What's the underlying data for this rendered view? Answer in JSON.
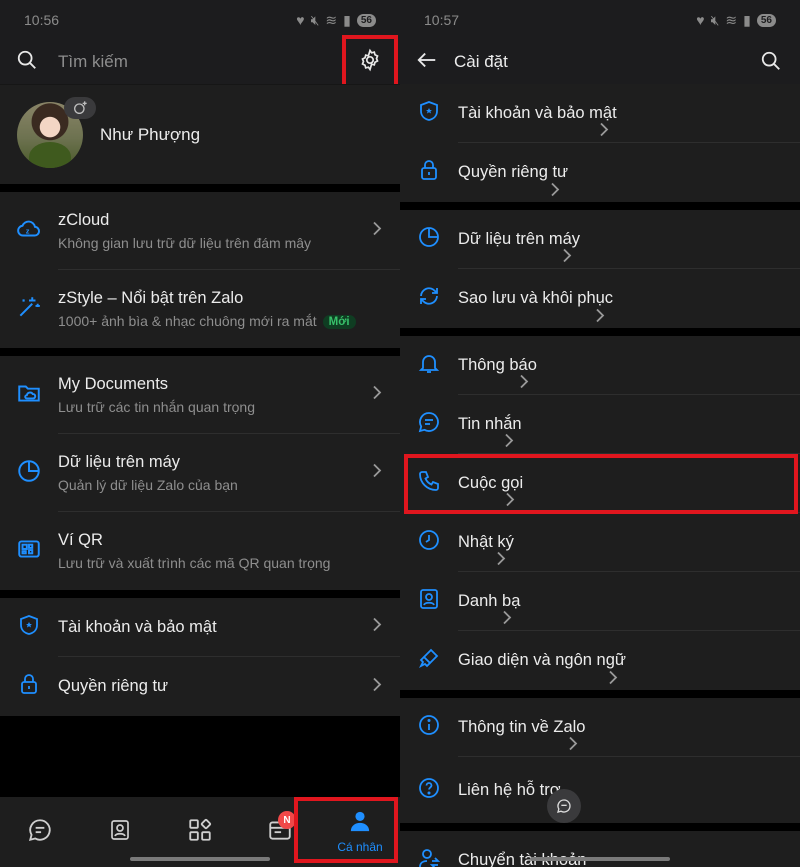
{
  "left": {
    "status": {
      "time": "10:56",
      "battery": "56"
    },
    "search": {
      "placeholder": "Tìm kiếm"
    },
    "profile": {
      "name": "Như Phượng"
    },
    "items": [
      {
        "title": "zCloud",
        "subtitle": "Không gian lưu trữ dữ liệu trên đám mây",
        "icon": "cloud-icon"
      },
      {
        "title": "zStyle – Nổi bật trên Zalo",
        "subtitle": "1000+ ảnh bìa & nhạc chuông mới ra mắt",
        "badge": "Mới",
        "icon": "magic-wand-icon"
      },
      {
        "title": "My Documents",
        "subtitle": "Lưu trữ các tin nhắn quan trọng",
        "icon": "folder-cloud-icon"
      },
      {
        "title": "Dữ liệu trên máy",
        "subtitle": "Quản lý dữ liệu Zalo của bạn",
        "icon": "pie-chart-icon"
      },
      {
        "title": "Ví QR",
        "subtitle": "Lưu trữ và xuất trình các mã QR quan trọng",
        "icon": "qr-wallet-icon"
      },
      {
        "title": "Tài khoản và bảo mật",
        "icon": "shield-icon"
      },
      {
        "title": "Quyền riêng tư",
        "icon": "lock-icon"
      }
    ],
    "nav": {
      "profile_label": "Cá nhân",
      "news_badge": "N"
    }
  },
  "right": {
    "status": {
      "time": "10:57",
      "battery": "56"
    },
    "header": {
      "title": "Cài đặt"
    },
    "sections": [
      [
        "Tài khoản và bảo mật",
        "Quyền riêng tư"
      ],
      [
        "Dữ liệu trên máy",
        "Sao lưu và khôi phục"
      ],
      [
        "Thông báo",
        "Tin nhắn",
        "Cuộc gọi",
        "Nhật ký",
        "Danh bạ",
        "Giao diện và ngôn ngữ"
      ],
      [
        "Thông tin về Zalo",
        "Liên hệ hỗ trợ"
      ],
      [
        "Chuyển tài khoản"
      ]
    ]
  },
  "colors": {
    "accent": "#1f8fff",
    "highlight": "#e0161e",
    "surface": "#1e1e1e"
  }
}
